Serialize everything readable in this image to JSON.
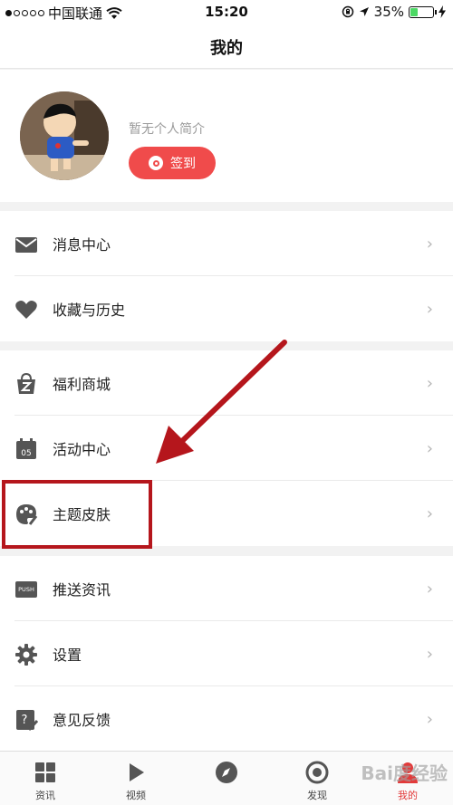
{
  "status_bar": {
    "carrier": "中国联通",
    "time": "15:20",
    "battery": "35%"
  },
  "nav": {
    "title": "我的"
  },
  "profile": {
    "bio": "暂无个人简介",
    "checkin_label": "签到"
  },
  "groups": [
    {
      "items": [
        {
          "label": "消息中心",
          "icon": "envelope-icon"
        },
        {
          "label": "收藏与历史",
          "icon": "heart-icon"
        }
      ]
    },
    {
      "items": [
        {
          "label": "福利商城",
          "icon": "shopping-bag-icon"
        },
        {
          "label": "活动中心",
          "icon": "calendar-icon",
          "icon_text": "05"
        },
        {
          "label": "主题皮肤",
          "icon": "palette-icon"
        }
      ]
    },
    {
      "items": [
        {
          "label": "推送资讯",
          "icon": "push-icon",
          "icon_text": "PUSH"
        },
        {
          "label": "设置",
          "icon": "gear-icon"
        },
        {
          "label": "意见反馈",
          "icon": "feedback-icon"
        }
      ]
    }
  ],
  "chevron": "›",
  "tabs": [
    {
      "label": "资讯",
      "icon": "grid-icon"
    },
    {
      "label": "视频",
      "icon": "play-icon"
    },
    {
      "label": "",
      "icon": "compass-icon"
    },
    {
      "label": "发现",
      "icon": "target-icon"
    },
    {
      "label": "我的",
      "icon": "user-icon",
      "active": true
    }
  ],
  "watermark": "Bai度经验",
  "colors": {
    "accent": "#f04b4b",
    "highlight": "#b5161c",
    "active_tab": "#e23a3a"
  }
}
